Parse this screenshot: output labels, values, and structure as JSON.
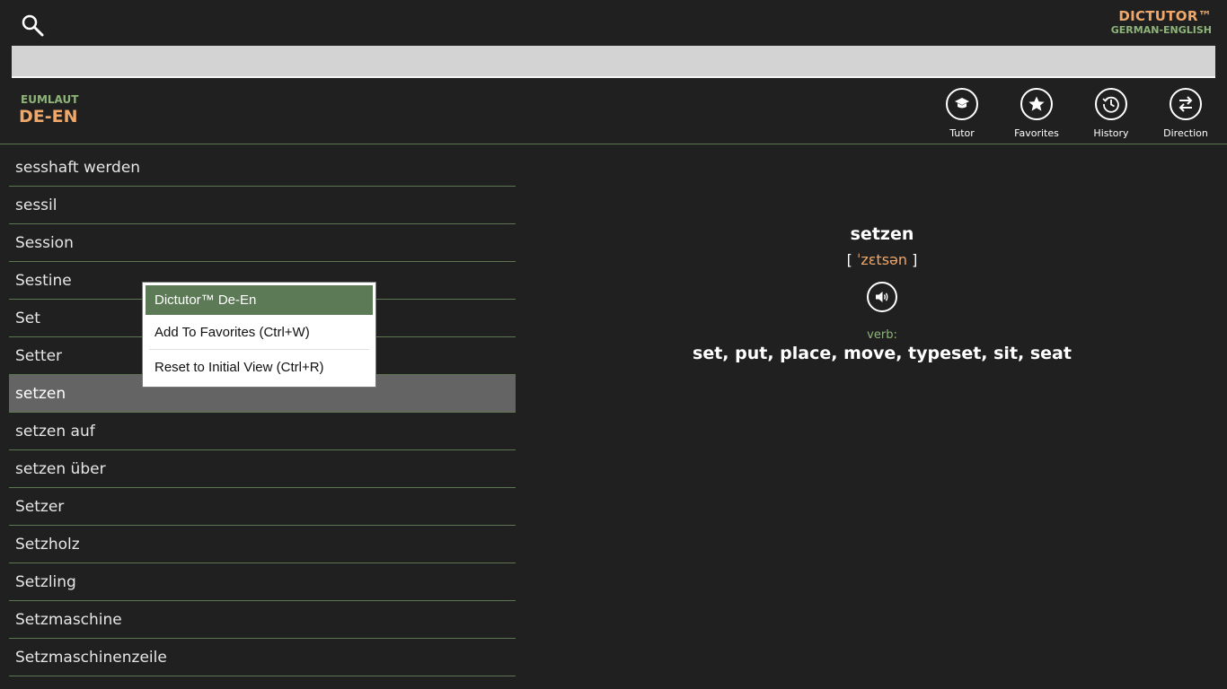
{
  "app": {
    "brand_title": "DICTUTOR™",
    "brand_subtitle": "GERMAN-ENGLISH",
    "dictionary_subtitle": "EUMLAUT",
    "dictionary_code": "DE-EN"
  },
  "search": {
    "value": "",
    "placeholder": ""
  },
  "toolbar": {
    "items": [
      {
        "label": "Tutor",
        "icon": "graduation-cap-icon"
      },
      {
        "label": "Favorites",
        "icon": "star-icon"
      },
      {
        "label": "History",
        "icon": "history-clock-icon"
      },
      {
        "label": "Direction",
        "icon": "swap-arrows-icon"
      }
    ]
  },
  "word_list": [
    "sesshaft werden",
    "sessil",
    "Session",
    "Sestine",
    "Set",
    "Setter",
    "setzen",
    "setzen auf",
    "setzen über",
    "Setzer",
    "Setzholz",
    "Setzling",
    "Setzmaschine",
    "Setzmaschinenzeile"
  ],
  "selected_word": "setzen",
  "detail": {
    "word": "setzen",
    "bracket_open": "[",
    "phonetic": "ˈzɛtsən",
    "bracket_close": "]",
    "part_of_speech": "verb:",
    "translation": "set, put, place, move, typeset, sit, seat"
  },
  "context_menu": {
    "items": [
      "Dictutor™ De-En",
      "Add To Favorites (Ctrl+W)",
      "Reset to Initial View (Ctrl+R)"
    ]
  },
  "colors": {
    "background": "#202020",
    "accent_orange": "#f0a86a",
    "accent_green": "#8fb47a",
    "divider": "#5d7651",
    "selected_row": "#646464",
    "menu_highlight": "#5d7a56"
  }
}
